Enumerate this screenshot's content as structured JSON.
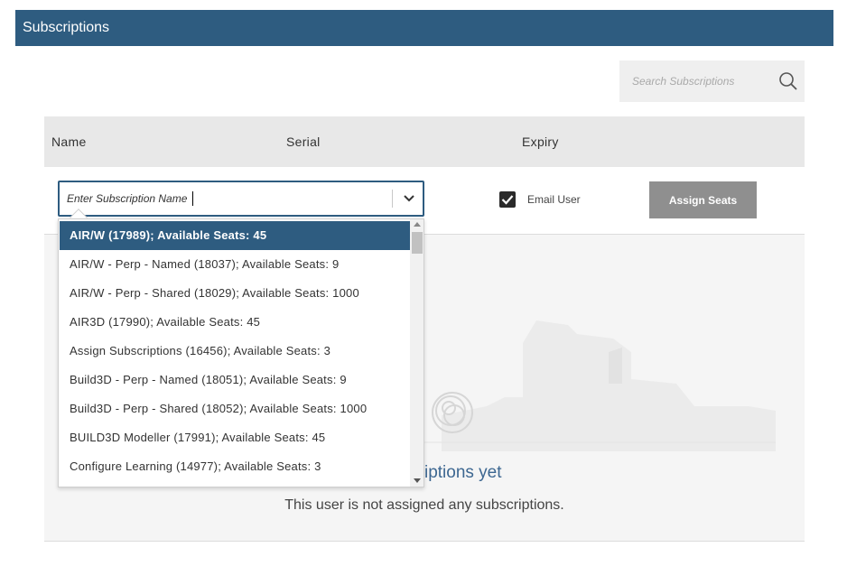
{
  "header": {
    "title": "Subscriptions"
  },
  "search": {
    "placeholder": "Search Subscriptions"
  },
  "table": {
    "columns": [
      "Name",
      "Serial",
      "Expiry"
    ]
  },
  "assign": {
    "input_placeholder": "Enter Subscription Name",
    "email_user_label": "Email User",
    "email_user_checked": true,
    "assign_button_label": "Assign Seats"
  },
  "dropdown": {
    "items": [
      {
        "label": "AIR/W (17989); Available Seats: 45"
      },
      {
        "label": "AIR/W - Perp - Named (18037); Available Seats: 9"
      },
      {
        "label": "AIR/W - Perp - Shared (18029); Available Seats: 1000"
      },
      {
        "label": "AIR3D (17990); Available Seats: 45"
      },
      {
        "label": "Assign Subscriptions (16456); Available Seats: 3"
      },
      {
        "label": "Build3D - Perp - Named (18051); Available Seats: 9"
      },
      {
        "label": "Build3D - Perp - Shared (18052); Available Seats: 1000"
      },
      {
        "label": "BUILD3D Modeller (17991); Available Seats: 45"
      },
      {
        "label": "Configure Learning (14977); Available Seats: 3"
      }
    ],
    "selected_index": 0
  },
  "empty_state": {
    "title": "No subscriptions yet",
    "description": "This user is not assigned any subscriptions."
  },
  "colors": {
    "brand": "#2e5c80",
    "button_disabled": "#8f8f8f",
    "empty_title": "#3d6791"
  }
}
